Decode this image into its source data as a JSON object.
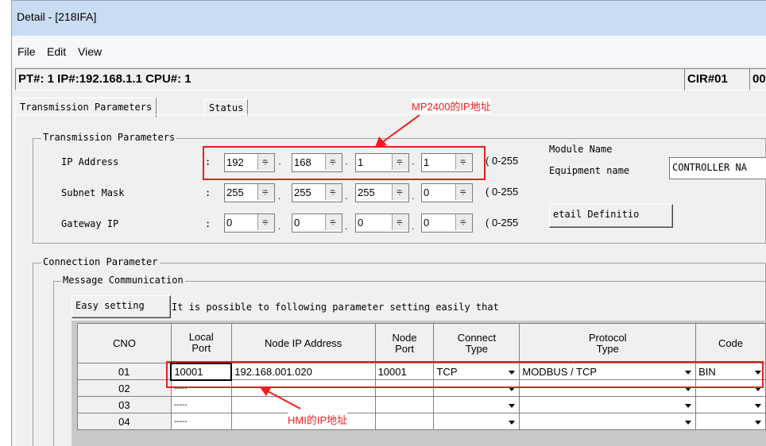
{
  "window": {
    "title": "Detail - [218IFA]"
  },
  "menu": [
    "File",
    "Edit",
    "View"
  ],
  "info": {
    "main": "PT#: 1 IP#:192.168.1.1 CPU#: 1",
    "cir": "CIR#01",
    "extra": "00"
  },
  "tabs": {
    "transmission": "Transmission Parameters",
    "status": "Status"
  },
  "transmission": {
    "group_title": "Transmission Parameters",
    "ip_label": "IP Address",
    "subnet_label": "Subnet  Mask",
    "gateway_label": "Gateway IP",
    "colon": ":",
    "ip": [
      "192",
      "168",
      "1",
      "1"
    ],
    "subnet": [
      "255",
      "255",
      "255",
      "0"
    ],
    "gateway": [
      "0",
      "0",
      "0",
      "0"
    ],
    "range": "( 0-255",
    "module_name_label": "Module Name",
    "equipment_label": "Equipment  name",
    "equipment_value": "CONTROLLER NA",
    "detail_button": "etail Definitio"
  },
  "connection": {
    "group_title": "Connection Parameter",
    "message_title": "Message Communication",
    "easy_button": "Easy setting",
    "easy_text": "It is possible to following parameter setting easily that",
    "headers": {
      "cno": "CNO",
      "local1": "Local",
      "local2": "Port",
      "nodeip": "Node IP Address",
      "nodeport1": "Node",
      "nodeport2": "Port",
      "connect1": "Connect",
      "connect2": "Type",
      "protocol1": "Protocol",
      "protocol2": "Type",
      "code": "Code"
    },
    "rows": [
      {
        "cno": "01",
        "local_port": "10001",
        "node_ip": "192.168.001.020",
        "node_port": "10001",
        "connect": "TCP",
        "protocol": "MODBUS / TCP",
        "code": "BIN"
      },
      {
        "cno": "02",
        "local_port": "-----",
        "node_ip": "",
        "node_port": "",
        "connect": "",
        "protocol": "",
        "code": ""
      },
      {
        "cno": "03",
        "local_port": "-----",
        "node_ip": "",
        "node_port": "",
        "connect": "",
        "protocol": "",
        "code": ""
      },
      {
        "cno": "04",
        "local_port": "-----",
        "node_ip": "",
        "node_port": "",
        "connect": "",
        "protocol": "",
        "code": ""
      }
    ]
  },
  "annotations": {
    "mp_ip": "MP2400的IP地址",
    "hmi_ip": "HMI的IP地址"
  },
  "colors": {
    "annotation": "#ee1c1c",
    "title_bar": "#c9dcf2",
    "panel": "#f0f0f0"
  }
}
